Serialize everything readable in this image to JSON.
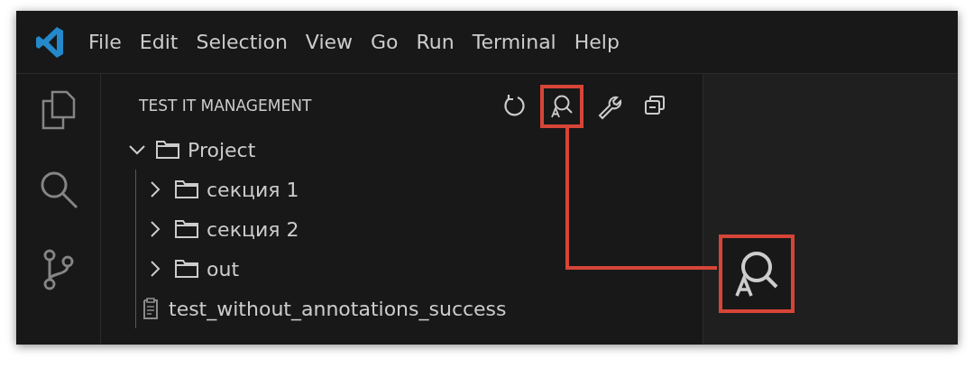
{
  "menu": [
    "File",
    "Edit",
    "Selection",
    "View",
    "Go",
    "Run",
    "Terminal",
    "Help"
  ],
  "sidebar": {
    "title": "TEST IT MANAGEMENT",
    "actions": [
      {
        "kind": "refresh",
        "highlighted": false
      },
      {
        "kind": "annotation-search",
        "highlighted": true
      },
      {
        "kind": "wrench",
        "highlighted": false
      },
      {
        "kind": "collapse",
        "highlighted": false
      }
    ],
    "tree": [
      {
        "kind": "folder",
        "label": "Project",
        "expanded": true,
        "children": [
          {
            "kind": "folder",
            "label": "секция 1",
            "expanded": false
          },
          {
            "kind": "folder",
            "label": "секция 2",
            "expanded": false
          },
          {
            "kind": "folder",
            "label": "out",
            "expanded": false
          },
          {
            "kind": "file",
            "label": "test_without_annotations_success"
          }
        ]
      }
    ]
  }
}
